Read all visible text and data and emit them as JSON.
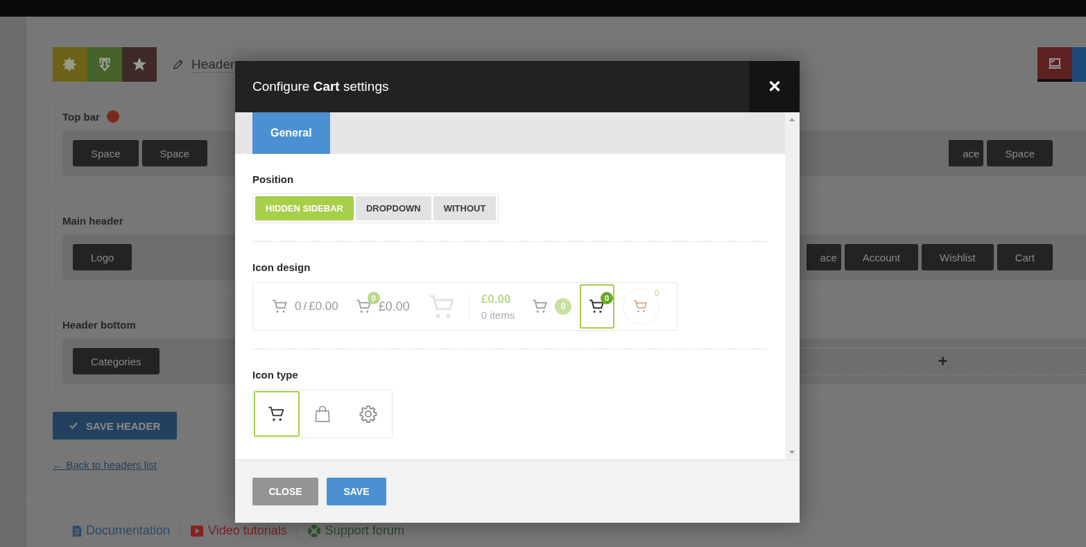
{
  "toolbar": {
    "title": "Header"
  },
  "sections": [
    {
      "title": "Top bar",
      "left": [
        "Space",
        "Space"
      ],
      "right": [
        "ace",
        "Space"
      ]
    },
    {
      "title": "Main header",
      "left": [
        "Logo"
      ],
      "right": [
        "ace",
        "Account",
        "Wishlist",
        "Cart"
      ]
    },
    {
      "title": "Header bottom",
      "left": [
        "Categories"
      ],
      "add_label": "+"
    }
  ],
  "save_header": "SAVE HEADER",
  "back_link": "← Back to headers list",
  "footer_links": [
    {
      "kind": "doc",
      "label": "Documentation"
    },
    {
      "kind": "video",
      "label": "Video tutorials"
    },
    {
      "kind": "support",
      "label": "Support forum"
    }
  ],
  "modal": {
    "title_prefix": "Configure ",
    "title_bold": "Cart",
    "title_suffix": " settings",
    "close": "✕",
    "tabs": [
      {
        "label": "General",
        "selected": true
      }
    ],
    "position": {
      "label": "Position",
      "options": [
        {
          "label": "HIDDEN SIDEBAR",
          "selected": true
        },
        {
          "label": "DROPDOWN",
          "selected": false
        },
        {
          "label": "WITHOUT",
          "selected": false
        }
      ]
    },
    "icon_design": {
      "label": "Icon design",
      "options": [
        {
          "kind": "count-total",
          "count": "0",
          "sep": "/",
          "amount": "£0.00",
          "selected": false
        },
        {
          "kind": "badge-total",
          "count": "0",
          "amount": "£0.00",
          "selected": false
        },
        {
          "kind": "large",
          "selected": false
        },
        {
          "kind": "amount-items",
          "amount": "£0.00",
          "items": "0 items",
          "selected": false
        },
        {
          "kind": "count-pill",
          "count": "0",
          "selected": false
        },
        {
          "kind": "badge",
          "count": "0",
          "selected": true
        },
        {
          "kind": "circle",
          "count": "0",
          "selected": false
        }
      ]
    },
    "icon_type": {
      "label": "Icon type",
      "options": [
        {
          "kind": "cart",
          "selected": true
        },
        {
          "kind": "bag",
          "selected": false
        },
        {
          "kind": "gear",
          "selected": false
        }
      ]
    },
    "buttons": [
      {
        "kind": "close",
        "label": "CLOSE"
      },
      {
        "kind": "save",
        "label": "SAVE"
      }
    ]
  }
}
